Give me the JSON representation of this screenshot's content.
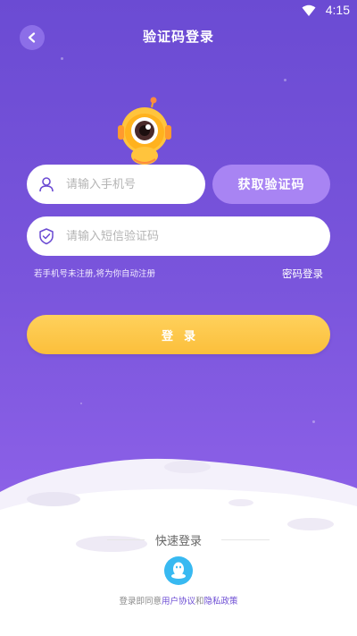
{
  "status_bar": {
    "time": "4:15"
  },
  "header": {
    "title": "验证码登录"
  },
  "form": {
    "phone_placeholder": "请输入手机号",
    "code_placeholder": "请输入短信验证码",
    "get_code_label": "获取验证码",
    "register_hint": "若手机号未注册,将为你自动注册",
    "password_login_label": "密码登录",
    "login_label": "登录"
  },
  "quick_login": {
    "label": "快速登录",
    "agreement_prefix": "登录即同意",
    "user_agreement": "用户协议",
    "and": "和",
    "privacy_policy": "隐私政策"
  },
  "colors": {
    "background_top": "#6b4bd3",
    "accent_purple": "#a884f3",
    "login_yellow": "#fbbf3b",
    "qq_blue": "#38b9f1"
  }
}
